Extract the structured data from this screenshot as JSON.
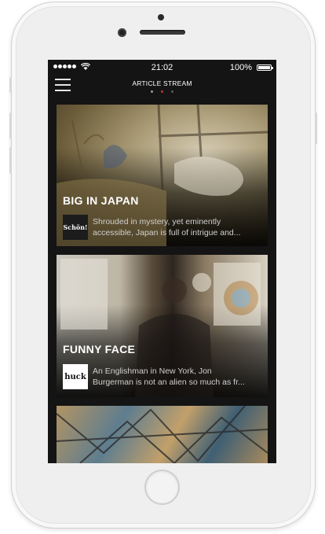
{
  "status_bar": {
    "time": "21:02",
    "battery": "100%"
  },
  "header": {
    "title": "ARTICLE STREAM",
    "page_dots": {
      "count": 3,
      "active_index": 0,
      "colors": [
        "#9a9a9a",
        "#c0392b",
        "#5a5a5a"
      ]
    }
  },
  "articles": [
    {
      "title": "BIG IN JAPAN",
      "publisher_logo": "Schön!",
      "excerpt_lines": [
        "Shrouded in mystery, yet eminently",
        "accessible, Japan is full of intrigue and..."
      ]
    },
    {
      "title": "FUNNY FACE",
      "publisher_logo": "huck",
      "excerpt_lines": [
        "An Englishman in New York, Jon",
        "Burgerman is not an alien so much as fr..."
      ]
    }
  ],
  "device": {
    "body_color": "#efefef",
    "screen_color": "#141414"
  }
}
